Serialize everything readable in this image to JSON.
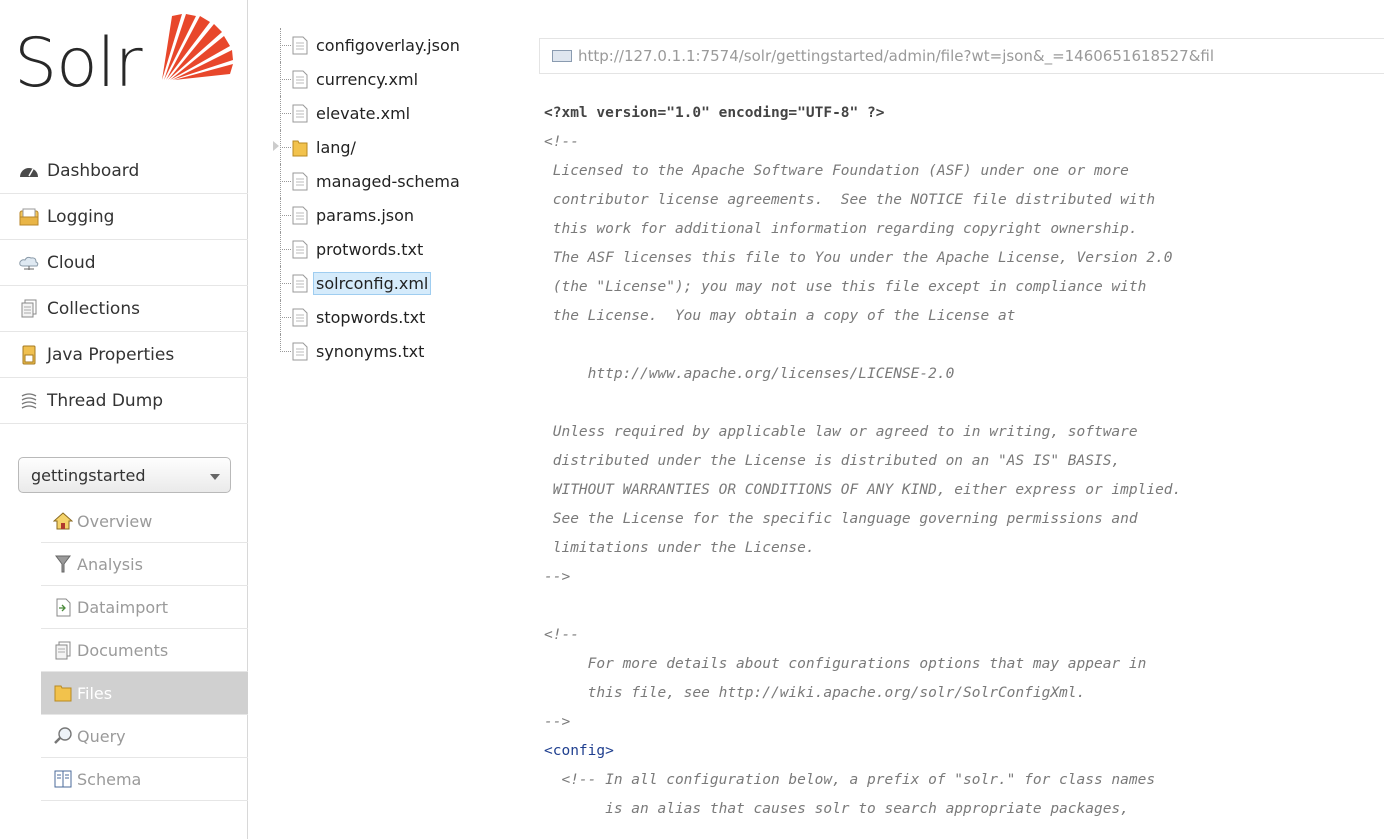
{
  "logo": {
    "text": "Solr"
  },
  "main_nav": [
    {
      "label": "Dashboard",
      "icon": "dashboard-icon"
    },
    {
      "label": "Logging",
      "icon": "logging-icon"
    },
    {
      "label": "Cloud",
      "icon": "cloud-icon"
    },
    {
      "label": "Collections",
      "icon": "collections-icon"
    },
    {
      "label": "Java Properties",
      "icon": "java-properties-icon"
    },
    {
      "label": "Thread Dump",
      "icon": "thread-dump-icon"
    }
  ],
  "core_selector": {
    "value": "gettingstarted"
  },
  "core_nav": [
    {
      "label": "Overview",
      "icon": "home-icon"
    },
    {
      "label": "Analysis",
      "icon": "funnel-icon"
    },
    {
      "label": "Dataimport",
      "icon": "dataimport-icon"
    },
    {
      "label": "Documents",
      "icon": "documents-icon"
    },
    {
      "label": "Files",
      "icon": "folder-icon",
      "active": true
    },
    {
      "label": "Query",
      "icon": "magnifier-icon"
    },
    {
      "label": "Schema",
      "icon": "schema-icon"
    }
  ],
  "file_tree": [
    {
      "name": "configoverlay.json",
      "type": "file"
    },
    {
      "name": "currency.xml",
      "type": "file"
    },
    {
      "name": "elevate.xml",
      "type": "file"
    },
    {
      "name": "lang/",
      "type": "folder"
    },
    {
      "name": "managed-schema",
      "type": "file"
    },
    {
      "name": "params.json",
      "type": "file"
    },
    {
      "name": "protwords.txt",
      "type": "file"
    },
    {
      "name": "solrconfig.xml",
      "type": "file",
      "selected": true
    },
    {
      "name": "stopwords.txt",
      "type": "file"
    },
    {
      "name": "synonyms.txt",
      "type": "file"
    }
  ],
  "file_url": "http://127.0.1.1:7574/solr/gettingstarted/admin/file?wt=json&_=1460651618527&fil",
  "code_lines": [
    {
      "text": "<?xml version=\"1.0\" encoding=\"UTF-8\" ?>",
      "style": "decl"
    },
    {
      "text": "<!--",
      "style": "comment"
    },
    {
      "text": " Licensed to the Apache Software Foundation (ASF) under one or more",
      "style": "comment"
    },
    {
      "text": " contributor license agreements.  See the NOTICE file distributed with",
      "style": "comment"
    },
    {
      "text": " this work for additional information regarding copyright ownership.",
      "style": "comment"
    },
    {
      "text": " The ASF licenses this file to You under the Apache License, Version 2.0",
      "style": "comment"
    },
    {
      "text": " (the \"License\"); you may not use this file except in compliance with",
      "style": "comment"
    },
    {
      "text": " the License.  You may obtain a copy of the License at",
      "style": "comment"
    },
    {
      "text": "",
      "style": "comment"
    },
    {
      "text": "     http://www.apache.org/licenses/LICENSE-2.0",
      "style": "comment"
    },
    {
      "text": "",
      "style": "comment"
    },
    {
      "text": " Unless required by applicable law or agreed to in writing, software",
      "style": "comment"
    },
    {
      "text": " distributed under the License is distributed on an \"AS IS\" BASIS,",
      "style": "comment"
    },
    {
      "text": " WITHOUT WARRANTIES OR CONDITIONS OF ANY KIND, either express or implied.",
      "style": "comment"
    },
    {
      "text": " See the License for the specific language governing permissions and",
      "style": "comment"
    },
    {
      "text": " limitations under the License.",
      "style": "comment"
    },
    {
      "text": "-->",
      "style": "comment"
    },
    {
      "text": "",
      "style": "comment"
    },
    {
      "text": "<!--",
      "style": "comment"
    },
    {
      "text": "     For more details about configurations options that may appear in",
      "style": "comment"
    },
    {
      "text": "     this file, see http://wiki.apache.org/solr/SolrConfigXml.",
      "style": "comment"
    },
    {
      "text": "-->",
      "style": "comment"
    },
    {
      "text": "<config>",
      "style": "tag"
    },
    {
      "text": "  <!-- In all configuration below, a prefix of \"solr.\" for class names",
      "style": "comment"
    },
    {
      "text": "       is an alias that causes solr to search appropriate packages,",
      "style": "comment"
    }
  ],
  "colors": {
    "selected_bg": "#d5ebfb",
    "tag": "#1f3f8f",
    "logo_orange": "#e8472b"
  }
}
